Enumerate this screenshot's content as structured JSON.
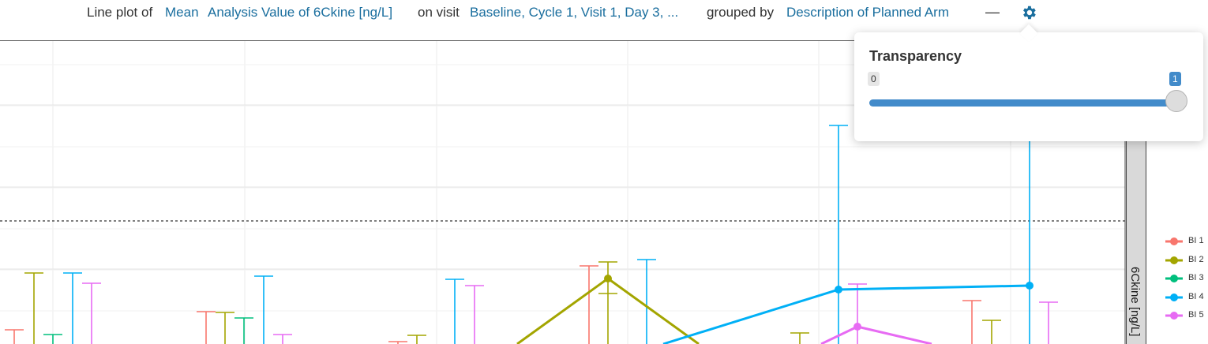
{
  "header": {
    "prefix": "Line plot of",
    "param_name": "Mean",
    "param_value": "Analysis Value of 6Ckine [ng/L]",
    "visit_label": "on visit",
    "visit_value": "Baseline, Cycle 1, Visit 1, Day 3, ...",
    "group_label": "grouped by",
    "group_value": "Description of Planned Arm",
    "minimize_label": "—",
    "settings_icon": "gear-icon",
    "link_color": "#1a6e9e"
  },
  "settings": {
    "title": "Transparency",
    "min_label": "0",
    "max_label": "1",
    "value": 1,
    "min": 0,
    "max": 1
  },
  "chart_data": {
    "type": "line",
    "strip_label": "6Ckine [ng/L]",
    "grid": true,
    "legend_position": "right",
    "reference_line": "dashed horizontal",
    "series": [
      {
        "name": "BI 1",
        "color": "#f8766d"
      },
      {
        "name": "BI 2",
        "color": "#a3a500"
      },
      {
        "name": "BI 3",
        "color": "#00bf7d"
      },
      {
        "name": "BI 4",
        "color": "#00b0f6"
      },
      {
        "name": "BI 5",
        "color": "#e76bf3"
      }
    ]
  }
}
